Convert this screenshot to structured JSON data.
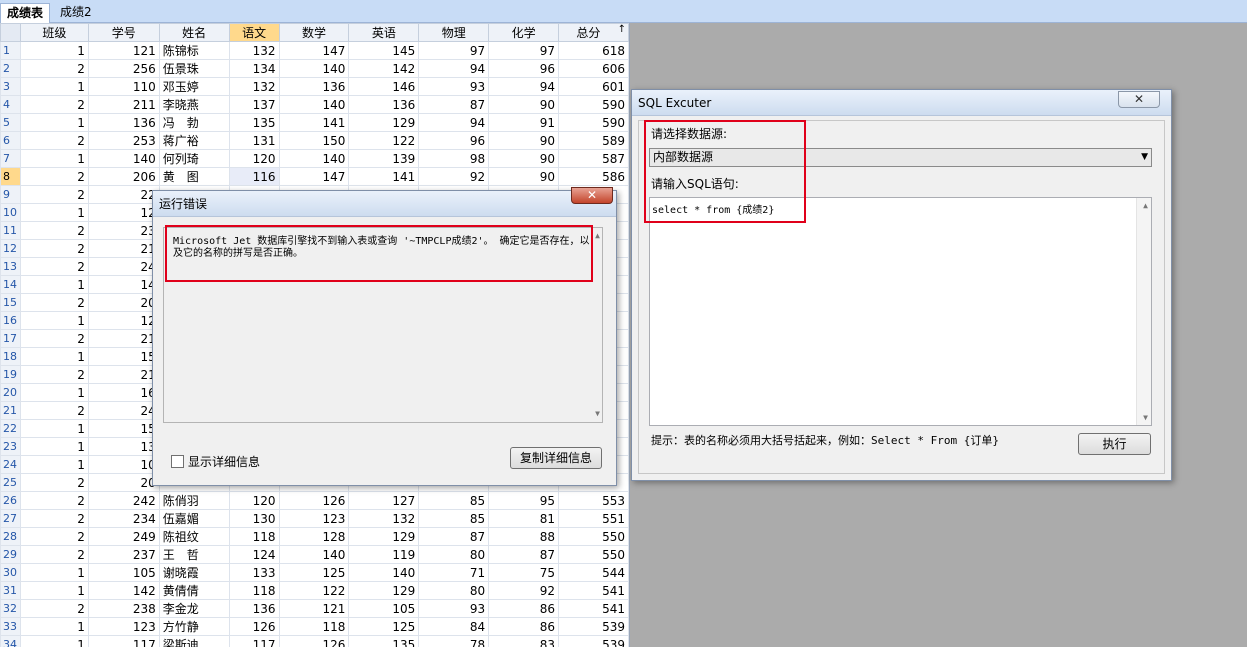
{
  "tabs": [
    "成绩表",
    "成绩2"
  ],
  "grid": {
    "columns": [
      "班级",
      "学号",
      "姓名",
      "语文",
      "数学",
      "英语",
      "物理",
      "化学",
      "总分"
    ],
    "rows": [
      [
        "1",
        "121",
        "陈锦标",
        "132",
        "147",
        "145",
        "97",
        "97",
        "618"
      ],
      [
        "2",
        "256",
        "伍景珠",
        "134",
        "140",
        "142",
        "94",
        "96",
        "606"
      ],
      [
        "1",
        "110",
        "邓玉婷",
        "132",
        "136",
        "146",
        "93",
        "94",
        "601"
      ],
      [
        "2",
        "211",
        "李晓燕",
        "137",
        "140",
        "136",
        "87",
        "90",
        "590"
      ],
      [
        "1",
        "136",
        "冯　勃",
        "135",
        "141",
        "129",
        "94",
        "91",
        "590"
      ],
      [
        "2",
        "253",
        "蒋广裕",
        "131",
        "150",
        "122",
        "96",
        "90",
        "589"
      ],
      [
        "1",
        "140",
        "何列琦",
        "120",
        "140",
        "139",
        "98",
        "90",
        "587"
      ],
      [
        "2",
        "206",
        "黄　图",
        "116",
        "147",
        "141",
        "92",
        "90",
        "586"
      ],
      [
        "2",
        "22",
        "",
        "",
        "",
        "",
        "",
        "",
        ""
      ],
      [
        "1",
        "12",
        "",
        "",
        "",
        "",
        "",
        "",
        ""
      ],
      [
        "2",
        "23",
        "",
        "",
        "",
        "",
        "",
        "",
        ""
      ],
      [
        "2",
        "21",
        "",
        "",
        "",
        "",
        "",
        "",
        ""
      ],
      [
        "2",
        "24",
        "",
        "",
        "",
        "",
        "",
        "",
        ""
      ],
      [
        "1",
        "14",
        "",
        "",
        "",
        "",
        "",
        "",
        ""
      ],
      [
        "2",
        "20",
        "",
        "",
        "",
        "",
        "",
        "",
        ""
      ],
      [
        "1",
        "12",
        "",
        "",
        "",
        "",
        "",
        "",
        ""
      ],
      [
        "2",
        "21",
        "",
        "",
        "",
        "",
        "",
        "",
        ""
      ],
      [
        "1",
        "15",
        "",
        "",
        "",
        "",
        "",
        "",
        ""
      ],
      [
        "2",
        "21",
        "",
        "",
        "",
        "",
        "",
        "",
        ""
      ],
      [
        "1",
        "16",
        "",
        "",
        "",
        "",
        "",
        "",
        ""
      ],
      [
        "2",
        "24",
        "",
        "",
        "",
        "",
        "",
        "",
        ""
      ],
      [
        "1",
        "15",
        "",
        "",
        "",
        "",
        "",
        "",
        ""
      ],
      [
        "1",
        "13",
        "",
        "",
        "",
        "",
        "",
        "",
        ""
      ],
      [
        "1",
        "10",
        "",
        "",
        "",
        "",
        "",
        "",
        ""
      ],
      [
        "2",
        "20",
        "",
        "",
        "",
        "",
        "",
        "",
        ""
      ],
      [
        "2",
        "242",
        "陈俏羽",
        "120",
        "126",
        "127",
        "85",
        "95",
        "553"
      ],
      [
        "2",
        "234",
        "伍嘉媚",
        "130",
        "123",
        "132",
        "85",
        "81",
        "551"
      ],
      [
        "2",
        "249",
        "陈祖纹",
        "118",
        "128",
        "129",
        "87",
        "88",
        "550"
      ],
      [
        "2",
        "237",
        "王　哲",
        "124",
        "140",
        "119",
        "80",
        "87",
        "550"
      ],
      [
        "1",
        "105",
        "谢晓霞",
        "133",
        "125",
        "140",
        "71",
        "75",
        "544"
      ],
      [
        "1",
        "142",
        "黄倩倩",
        "118",
        "122",
        "129",
        "80",
        "92",
        "541"
      ],
      [
        "2",
        "238",
        "李金龙",
        "136",
        "121",
        "105",
        "93",
        "86",
        "541"
      ],
      [
        "1",
        "123",
        "方竹静",
        "126",
        "118",
        "125",
        "84",
        "86",
        "539"
      ],
      [
        "1",
        "117",
        "梁斯迪",
        "117",
        "126",
        "135",
        "78",
        "83",
        "539"
      ]
    ]
  },
  "error_dialog": {
    "title": "运行错误",
    "close": "✕",
    "message": "Microsoft Jet 数据库引擎找不到输入表或查询 '~TMPCLP成绩2'。 确定它是否存在，以及它的名称的拼写是否正确。",
    "show_detail_label": "显示详细信息",
    "copy_button": "复制详细信息"
  },
  "sql_window": {
    "title": "SQL Excuter",
    "close": "✕",
    "datasource_label": "请选择数据源:",
    "datasource_value": "内部数据源",
    "sql_label": "请输入SQL语句:",
    "sql_text": "select * from {成绩2}",
    "hint": "提示：表的名称必须用大括号括起来，例如：Select * From {订单}",
    "execute_button": "执行"
  },
  "colors": {
    "highlight_box": "#e0001a",
    "selected_header": "#ffd98c",
    "tab_bar": "#c8dcf6"
  }
}
